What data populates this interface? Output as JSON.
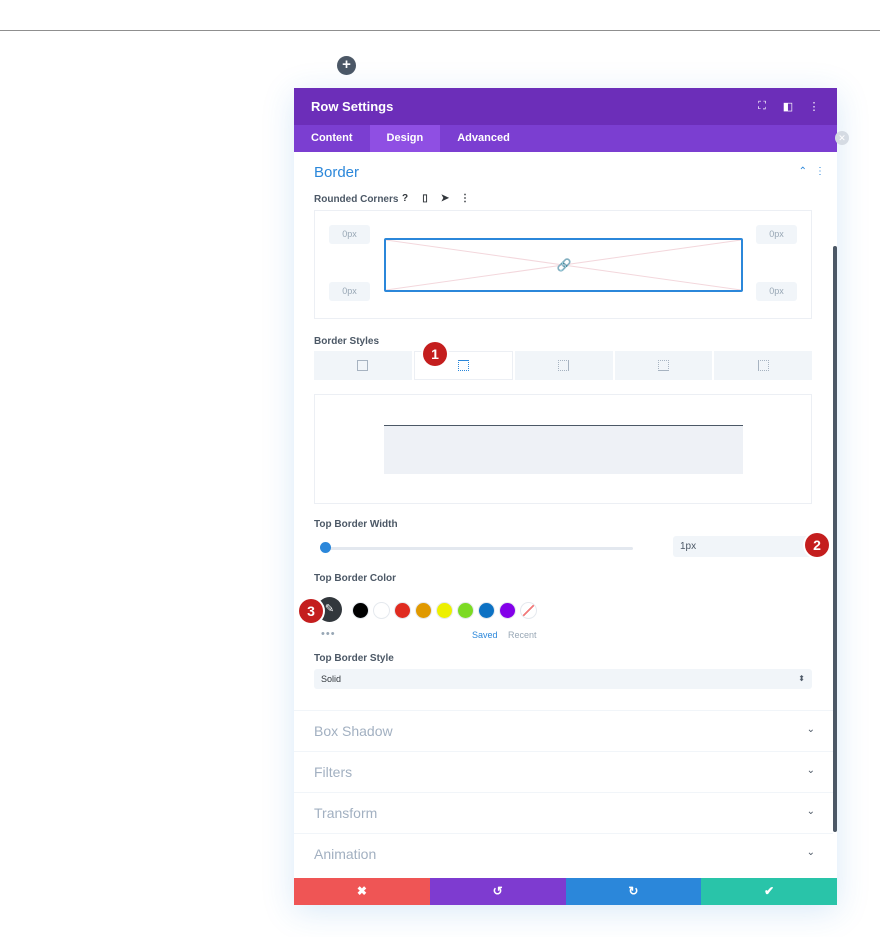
{
  "modal": {
    "title": "Row Settings",
    "tabs": [
      "Content",
      "Design",
      "Advanced"
    ],
    "active_tab": "Design"
  },
  "border": {
    "section_title": "Border",
    "rounded_corners_label": "Rounded Corners",
    "corners": {
      "top_left": "0px",
      "top_right": "0px",
      "bottom_left": "0px",
      "bottom_right": "0px"
    },
    "border_styles_label": "Border Styles",
    "top_border_width_label": "Top Border Width",
    "top_border_width_value": "1px",
    "top_border_width_fraction": 0.0,
    "top_border_color_label": "Top Border Color",
    "color_tabs": {
      "saved": "Saved",
      "recent": "Recent"
    },
    "swatches": [
      "#000000",
      "#ffffff",
      "#e02b20",
      "#e09900",
      "#edf000",
      "#7cda24",
      "#0c71c3",
      "#8300e9"
    ],
    "top_border_style_label": "Top Border Style",
    "top_border_style_value": "Solid"
  },
  "accordions": [
    "Box Shadow",
    "Filters",
    "Transform",
    "Animation"
  ],
  "markers": {
    "m1": "1",
    "m2": "2",
    "m3": "3"
  },
  "icons": {
    "add": "+",
    "expand": "⛶",
    "layout": "◧",
    "more": "⋮",
    "collapse": "⌃",
    "help": "?",
    "mobile": "▯",
    "cursor": "➤",
    "link": "🔗",
    "eyedropper": "✎",
    "dots": "•••",
    "chevron_down": "⌄",
    "select_arrow": "⬍",
    "cancel": "✖",
    "undo": "↺",
    "redo": "↻",
    "confirm": "✔",
    "close": "✕"
  },
  "colors": {
    "header": "#6c2eb9",
    "tabs": "#7b3ed1",
    "accent": "#2b87da",
    "cancel": "#ef5555",
    "undo": "#7e3bd0",
    "redo": "#2b87da",
    "save": "#29c4a9"
  }
}
